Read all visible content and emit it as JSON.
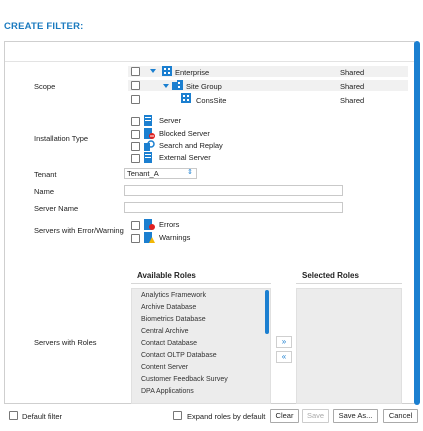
{
  "header": {
    "title": "CREATE FILTER:"
  },
  "form": {
    "scope": {
      "label": "Scope",
      "rows": [
        {
          "name": "Enterprise",
          "status": "Shared"
        },
        {
          "name": "Site Group",
          "status": "Shared"
        },
        {
          "name": "ConsSite",
          "status": "Shared"
        }
      ]
    },
    "installation_type": {
      "label": "Installation Type",
      "options": [
        "Server",
        "Blocked Server",
        "Search and Replay",
        "External Server"
      ]
    },
    "tenant": {
      "label": "Tenant",
      "value": "Tenant_A"
    },
    "name": {
      "label": "Name",
      "value": ""
    },
    "server_name": {
      "label": "Server Name",
      "value": ""
    },
    "servers_error": {
      "label": "Servers with Error/Warning",
      "options": [
        "Errors",
        "Warnings"
      ]
    },
    "roles": {
      "label": "Servers with Roles",
      "available_title": "Available Roles",
      "selected_title": "Selected Roles",
      "available": [
        "Analytics Framework",
        "Archive Database",
        "Biometrics Database",
        "Central Archive",
        "Contact Database",
        "Contact OLTP Database",
        "Content Server",
        "Customer Feedback Survey",
        "DPA Applications"
      ],
      "add_symbol": "»",
      "remove_symbol": "«"
    }
  },
  "footer": {
    "default_filter_label": "Default filter",
    "expand_roles_label": "Expand roles by default",
    "buttons": {
      "clear": "Clear",
      "save": "Save",
      "save_as": "Save As...",
      "cancel": "Cancel"
    }
  },
  "colors": {
    "accent": "#1b7fd0",
    "title": "#1a7abf"
  }
}
